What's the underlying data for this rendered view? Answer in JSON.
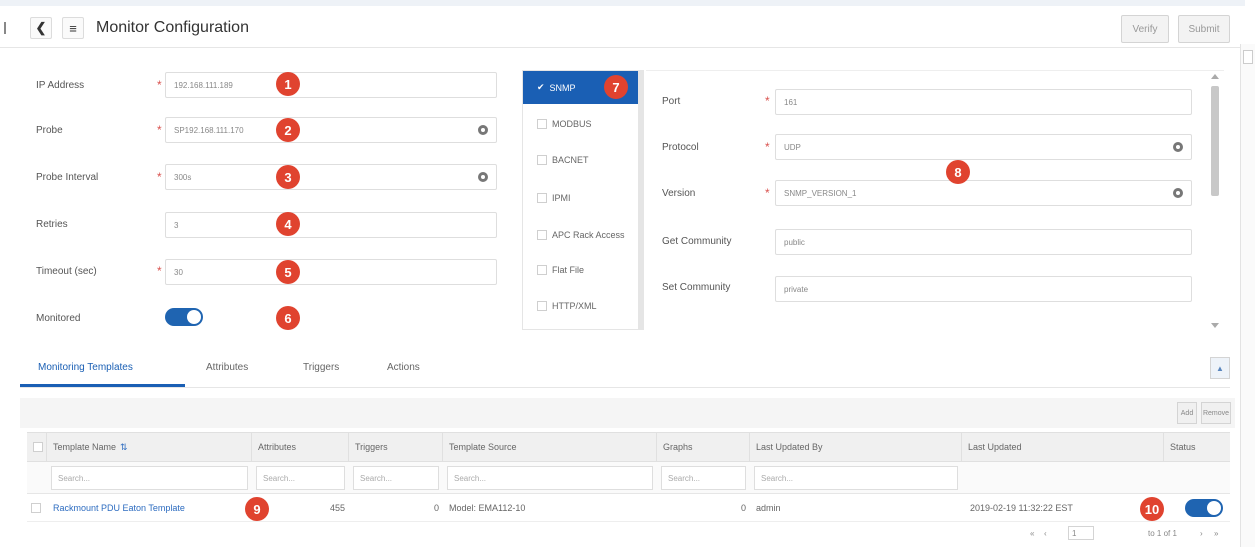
{
  "header": {
    "title": "Monitor Configuration",
    "back_icon": "chevron-left-icon",
    "menu_icon": "menu-icon",
    "verify_label": "Verify",
    "submit_label": "Submit"
  },
  "form": {
    "ip_address_label": "IP Address",
    "ip_address_value": "192.168.111.189",
    "probe_label": "Probe",
    "probe_value": "SP192.168.111.170",
    "probe_interval_label": "Probe Interval",
    "probe_interval_value": "300s",
    "retries_label": "Retries",
    "retries_value": "3",
    "timeout_label": "Timeout (sec)",
    "timeout_value": "30",
    "monitored_label": "Monitored",
    "monitored_on": true,
    "required_mark": "*"
  },
  "protocols": {
    "items": [
      "SNMP",
      "MODBUS",
      "BACNET",
      "IPMI",
      "APC Rack Access",
      "Flat File",
      "HTTP/XML"
    ],
    "selected": "SNMP",
    "check_glyph": "✔"
  },
  "snmp": {
    "port_label": "Port",
    "port_value": "161",
    "protocol_label": "Protocol",
    "protocol_value": "UDP",
    "version_label": "Version",
    "version_value": "SNMP_VERSION_1",
    "get_community_label": "Get Community",
    "get_community_value": "public",
    "set_community_label": "Set Community",
    "set_community_value": "private"
  },
  "tabs": [
    "Monitoring Templates",
    "Attributes",
    "Triggers",
    "Actions"
  ],
  "table": {
    "add_label": "Add",
    "remove_label": "Remove",
    "columns": [
      "Template Name",
      "Attributes",
      "Triggers",
      "Template Source",
      "Graphs",
      "Last Updated By",
      "Last Updated",
      "Status"
    ],
    "search_placeholder": "Search...",
    "rows": [
      {
        "name": "Rackmount PDU Eaton Template",
        "attributes": "455",
        "triggers": "0",
        "source": "Model: EMA112-10",
        "graphs": "0",
        "updated_by": "admin",
        "updated": "2019-02-19 11:32:22 EST",
        "status_on": true
      }
    ]
  },
  "pager": {
    "first": "«",
    "prev": "‹",
    "page": "1",
    "info": "to 1 of 1",
    "next": "›",
    "last": "»"
  },
  "badges": [
    "1",
    "2",
    "3",
    "4",
    "5",
    "6",
    "7",
    "8",
    "9",
    "10"
  ],
  "colors": {
    "accent": "#1a5fb4",
    "badge": "#e0432f",
    "required": "#d9534f"
  }
}
